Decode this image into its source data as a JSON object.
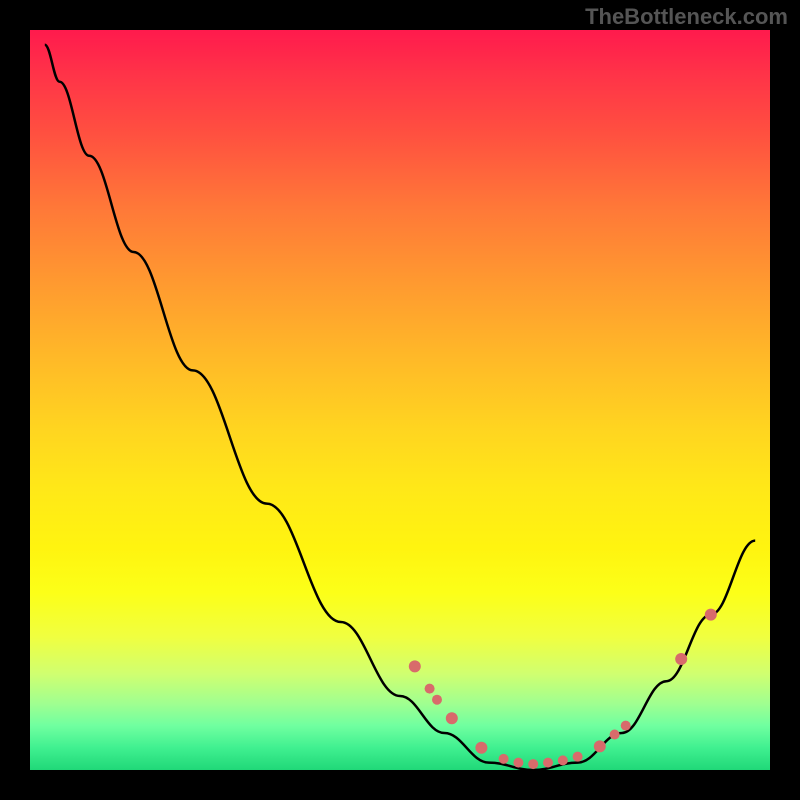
{
  "watermark": "TheBottleneck.com",
  "chart_data": {
    "type": "line",
    "title": "",
    "xlabel": "",
    "ylabel": "",
    "xlim": [
      0,
      100
    ],
    "ylim": [
      0,
      100
    ],
    "curve_points": [
      {
        "x": 2,
        "y": 98
      },
      {
        "x": 4,
        "y": 93
      },
      {
        "x": 8,
        "y": 83
      },
      {
        "x": 14,
        "y": 70
      },
      {
        "x": 22,
        "y": 54
      },
      {
        "x": 32,
        "y": 36
      },
      {
        "x": 42,
        "y": 20
      },
      {
        "x": 50,
        "y": 10
      },
      {
        "x": 56,
        "y": 5
      },
      {
        "x": 62,
        "y": 1
      },
      {
        "x": 68,
        "y": 0
      },
      {
        "x": 74,
        "y": 1
      },
      {
        "x": 80,
        "y": 5
      },
      {
        "x": 86,
        "y": 12
      },
      {
        "x": 92,
        "y": 21
      },
      {
        "x": 98,
        "y": 31
      }
    ],
    "marked_points": [
      {
        "x": 52,
        "y": 14,
        "r": 6
      },
      {
        "x": 54,
        "y": 11,
        "r": 5
      },
      {
        "x": 55,
        "y": 9.5,
        "r": 5
      },
      {
        "x": 57,
        "y": 7,
        "r": 6
      },
      {
        "x": 61,
        "y": 3,
        "r": 6
      },
      {
        "x": 64,
        "y": 1.5,
        "r": 5
      },
      {
        "x": 66,
        "y": 1,
        "r": 5
      },
      {
        "x": 68,
        "y": 0.8,
        "r": 5
      },
      {
        "x": 70,
        "y": 1,
        "r": 5
      },
      {
        "x": 72,
        "y": 1.3,
        "r": 5
      },
      {
        "x": 74,
        "y": 1.8,
        "r": 5
      },
      {
        "x": 77,
        "y": 3.2,
        "r": 6
      },
      {
        "x": 79,
        "y": 4.8,
        "r": 5
      },
      {
        "x": 80.5,
        "y": 6,
        "r": 5
      },
      {
        "x": 88,
        "y": 15,
        "r": 6
      },
      {
        "x": 92,
        "y": 21,
        "r": 6
      }
    ]
  }
}
